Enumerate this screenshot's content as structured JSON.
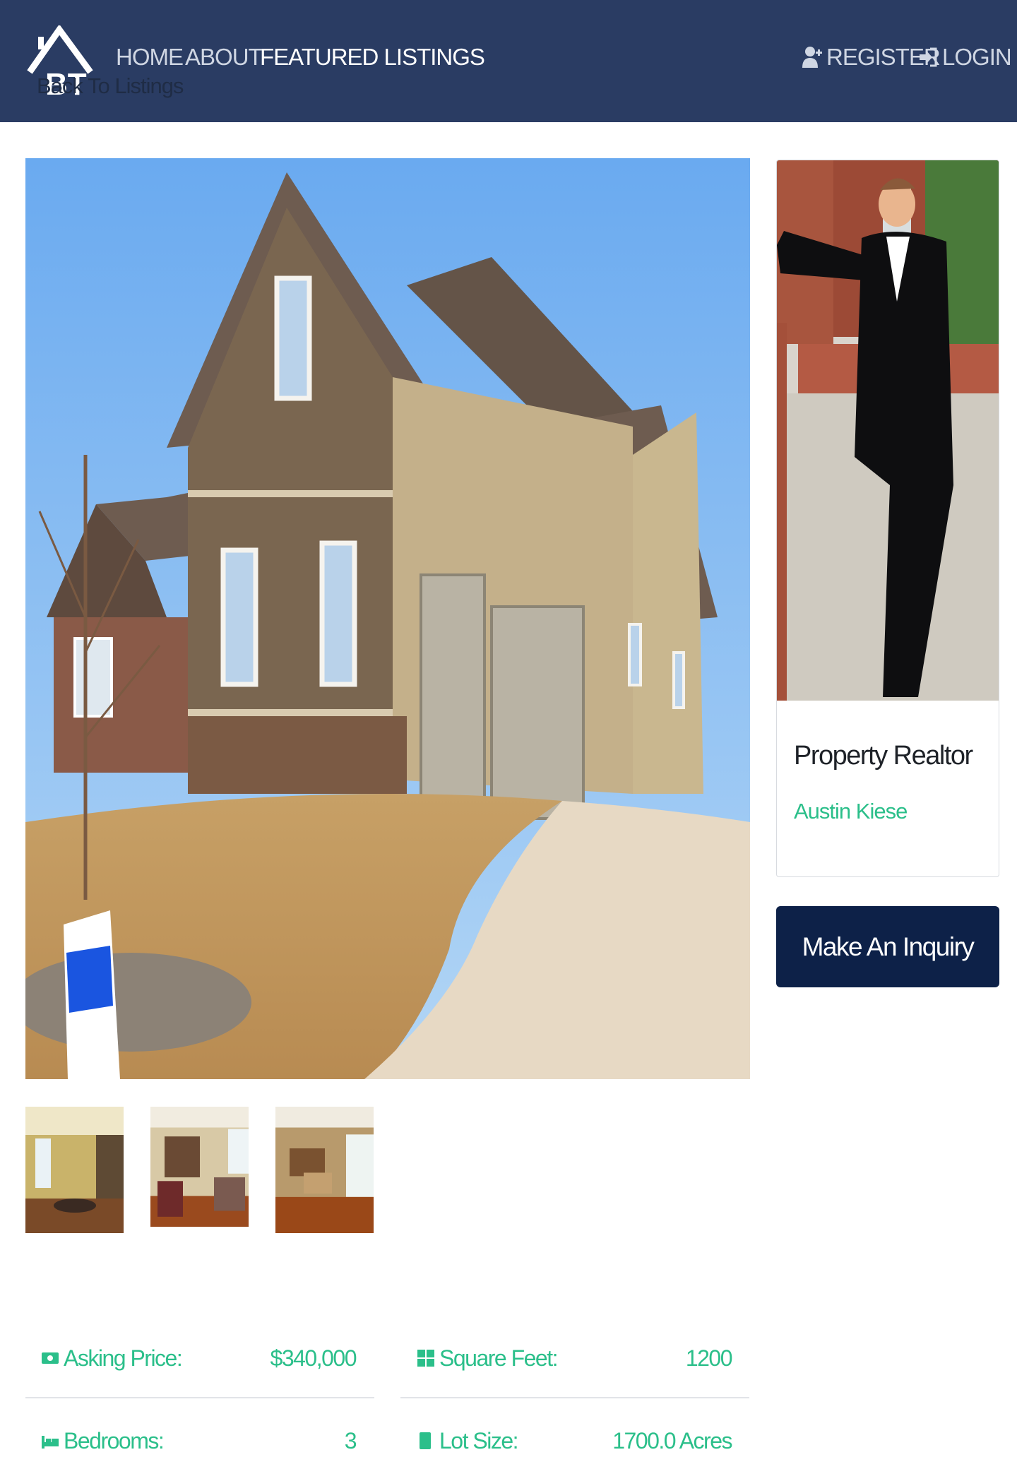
{
  "navbar": {
    "logo_text": "BT",
    "links": [
      {
        "label": "HOME"
      },
      {
        "label": "ABOUT"
      },
      {
        "label": "FEATURED LISTINGS"
      }
    ],
    "register_label": "REGISTER",
    "login_label": "LOGIN"
  },
  "back_link": "Back To Listings",
  "realtor": {
    "title": "Property Realtor",
    "name": "Austin Kiese"
  },
  "inquiry_button": "Make An Inquiry",
  "details": {
    "asking_price_label": "Asking Price:",
    "asking_price_value": "$340,000",
    "square_feet_label": "Square Feet:",
    "square_feet_value": "1200",
    "bedrooms_label": "Bedrooms:",
    "bedrooms_value": "3",
    "lot_size_label": "Lot Size:",
    "lot_size_value": "1700.0 Acres"
  },
  "colors": {
    "navbar": "#2a3c63",
    "accent": "#2bbf8a",
    "button": "#0d2148"
  },
  "icons": [
    "home-logo-icon",
    "user-plus-icon",
    "sign-in-icon",
    "money-icon",
    "grid-icon",
    "bed-icon",
    "square-icon"
  ]
}
